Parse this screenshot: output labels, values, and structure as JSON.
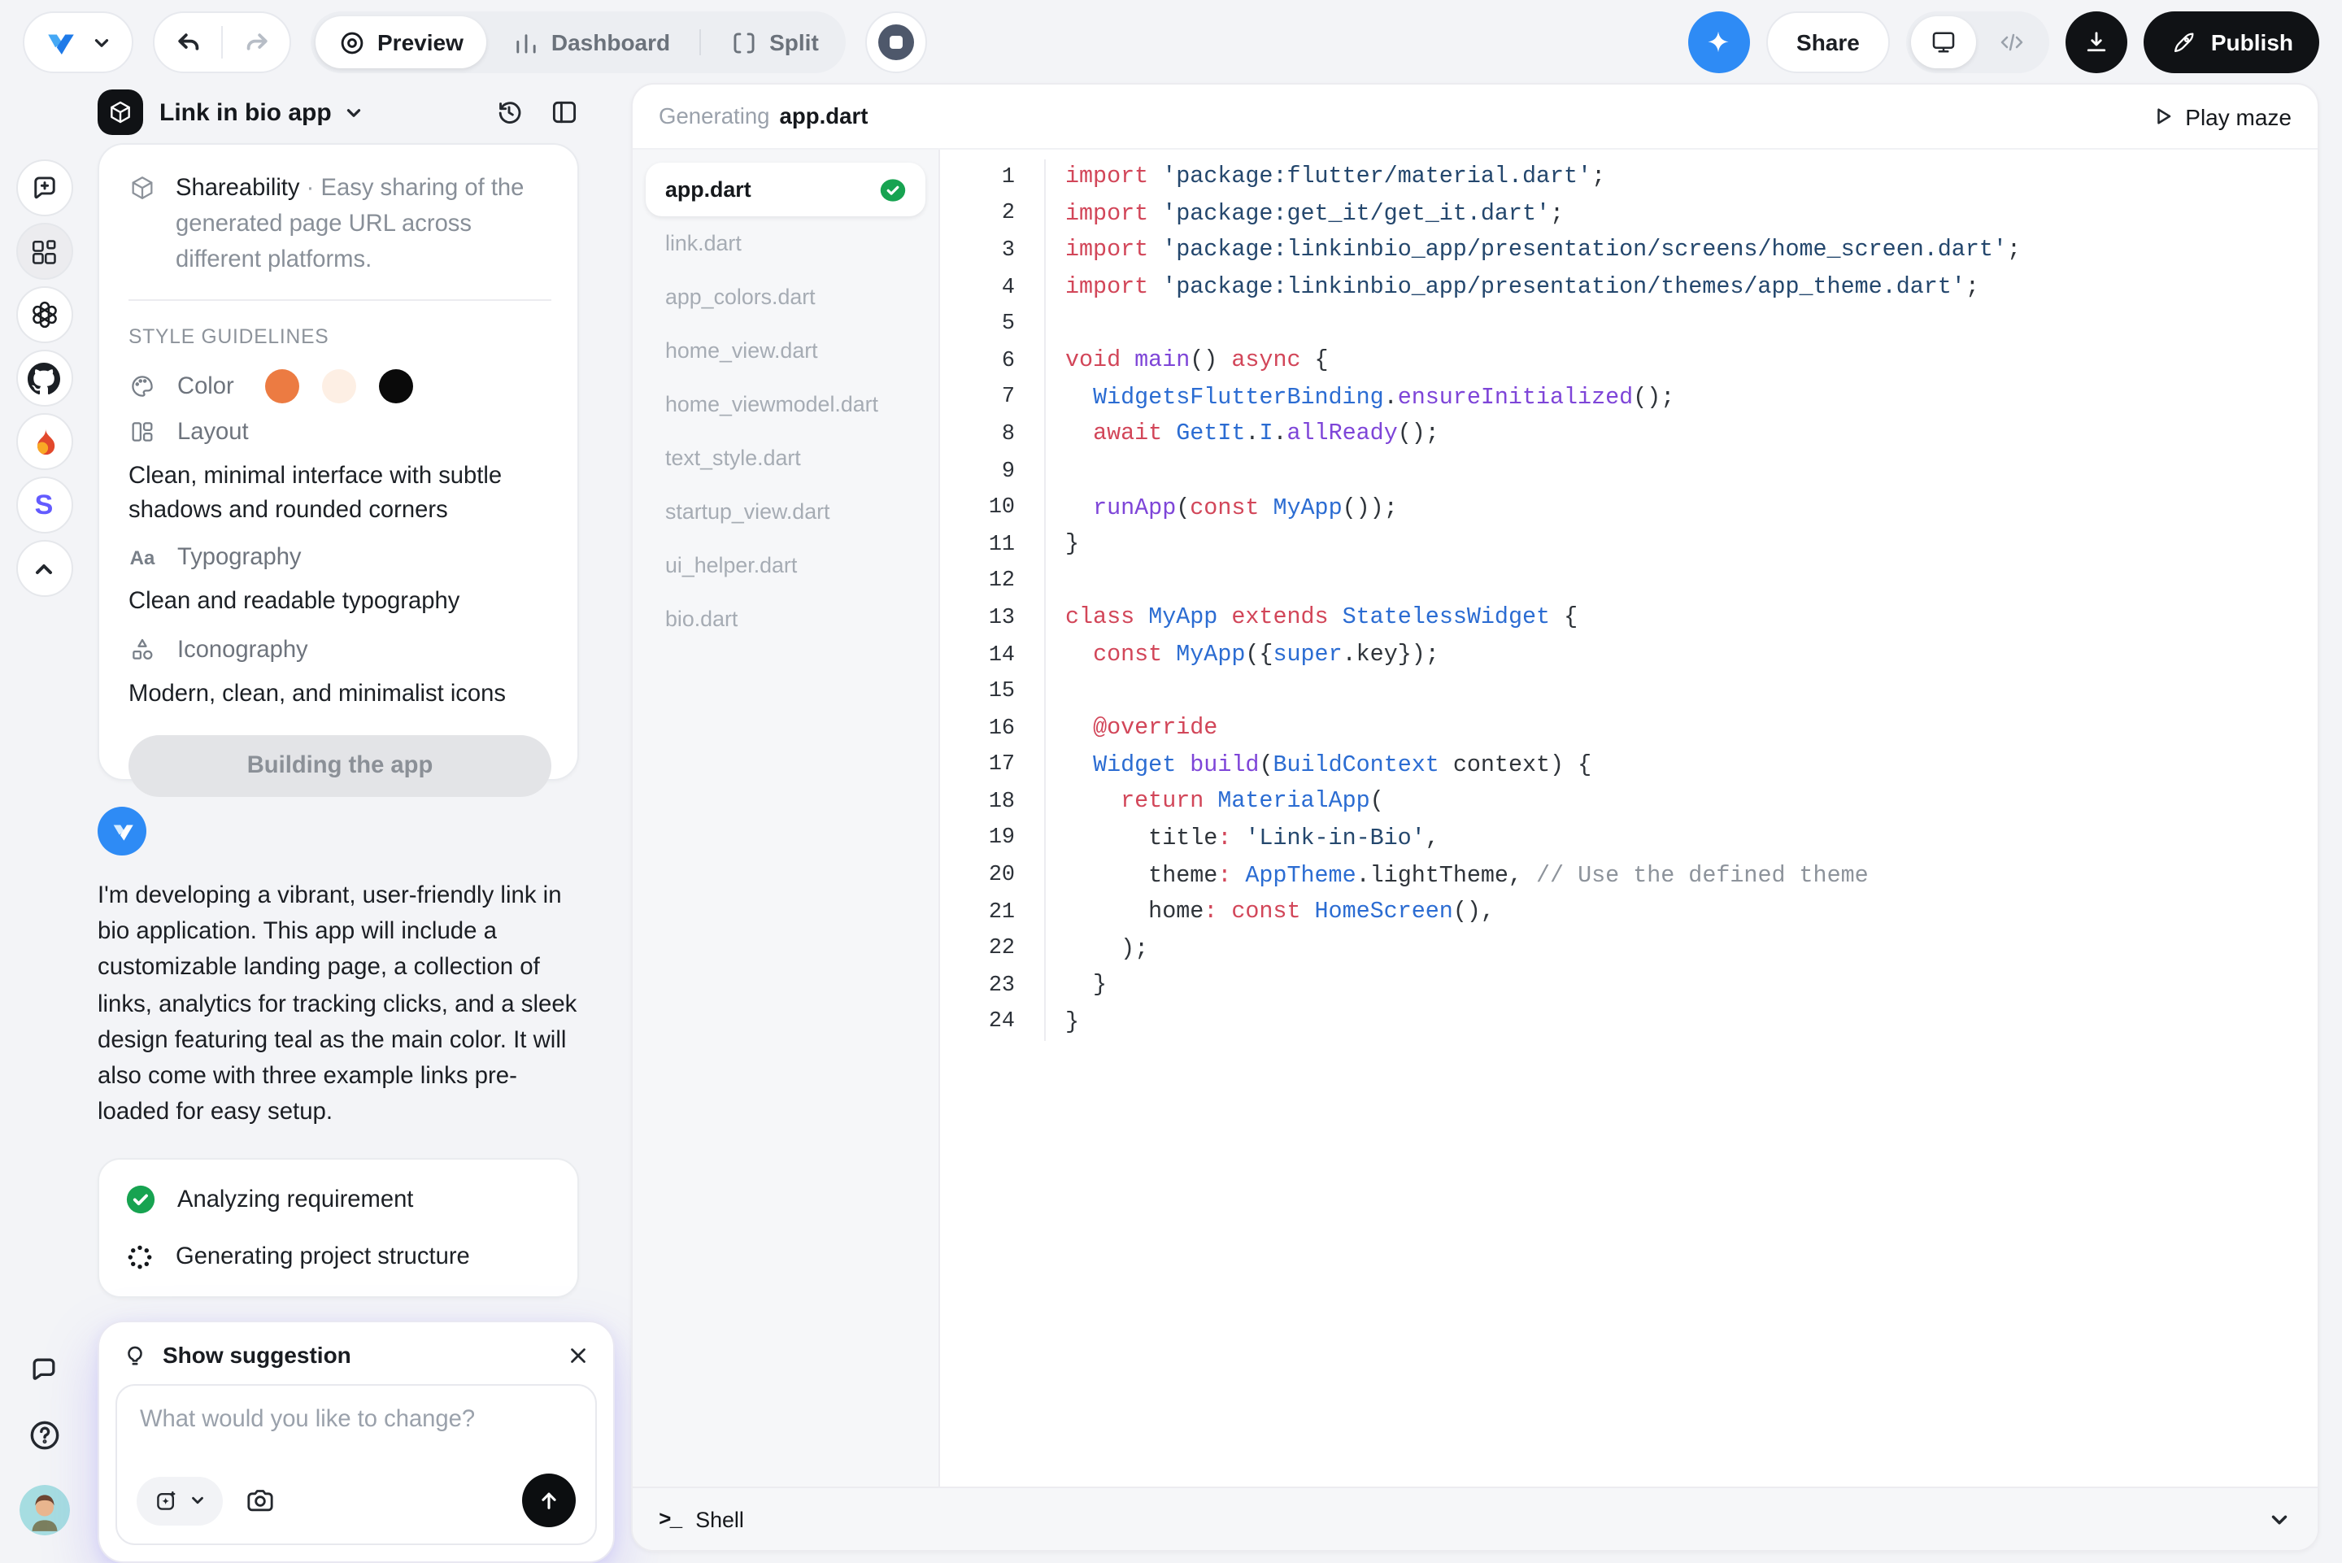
{
  "topbar": {
    "preview_label": "Preview",
    "dashboard_label": "Dashboard",
    "split_label": "Split",
    "share_label": "Share",
    "publish_label": "Publish"
  },
  "panel": {
    "title": "Link in bio app",
    "feature": {
      "name": "Shareability",
      "separator": "·",
      "desc": "Easy sharing of the generated page URL across different platforms."
    },
    "guidelines": {
      "heading": "STYLE GUIDELINES",
      "color_label": "Color",
      "swatches": [
        "#ec7b42",
        "#fdefe4",
        "#0a0a0a"
      ],
      "layout_label": "Layout",
      "layout_desc": "Clean, minimal interface with subtle shadows and rounded corners",
      "typography_label": "Typography",
      "typography_icon_text": "Aa",
      "typography_desc": "Clean and readable typography",
      "iconography_label": "Iconography",
      "iconography_desc": "Modern, clean, and minimalist icons"
    },
    "building_label": "Building the app",
    "message": "I'm developing a vibrant, user-friendly link in bio application. This app will include a customizable landing page, a collection of links, analytics for tracking clicks, and a sleek design featuring teal as the main color. It will also come with three example links pre-loaded for easy setup.",
    "status": [
      {
        "label": "Analyzing requirement",
        "state": "done"
      },
      {
        "label": "Generating project structure",
        "state": "loading"
      }
    ],
    "suggestion": {
      "title": "Show suggestion",
      "placeholder": "What would you like to change?"
    }
  },
  "rail": {
    "stripe_letter": "S"
  },
  "editor": {
    "header": {
      "prefix": "Generating",
      "file": "app.dart",
      "action": "Play maze"
    },
    "files": [
      {
        "name": "app.dart",
        "active": true,
        "badge": "check"
      },
      {
        "name": "link.dart"
      },
      {
        "name": "app_colors.dart"
      },
      {
        "name": "home_view.dart"
      },
      {
        "name": "home_viewmodel.dart"
      },
      {
        "name": "text_style.dart"
      },
      {
        "name": "startup_view.dart"
      },
      {
        "name": "ui_helper.dart"
      },
      {
        "name": "bio.dart"
      }
    ],
    "lines": [
      [
        [
          "kw",
          "import"
        ],
        [
          "pl",
          " "
        ],
        [
          "str",
          "'package:flutter/material.dart'"
        ],
        [
          "pl",
          ";"
        ]
      ],
      [
        [
          "kw",
          "import"
        ],
        [
          "pl",
          " "
        ],
        [
          "str",
          "'package:get_it/get_it.dart'"
        ],
        [
          "pl",
          ";"
        ]
      ],
      [
        [
          "kw",
          "import"
        ],
        [
          "pl",
          " "
        ],
        [
          "str",
          "'package:linkinbio_app/presentation/screens/home_screen.dart'"
        ],
        [
          "pl",
          ";"
        ]
      ],
      [
        [
          "kw",
          "import"
        ],
        [
          "pl",
          " "
        ],
        [
          "str",
          "'package:linkinbio_app/presentation/themes/app_theme.dart'"
        ],
        [
          "pl",
          ";"
        ]
      ],
      [],
      [
        [
          "kw",
          "void"
        ],
        [
          "pl",
          " "
        ],
        [
          "fn",
          "main"
        ],
        [
          "pl",
          "() "
        ],
        [
          "kw",
          "async"
        ],
        [
          "pl",
          " {"
        ]
      ],
      [
        [
          "pl",
          "  "
        ],
        [
          "ty",
          "WidgetsFlutterBinding"
        ],
        [
          "pl",
          "."
        ],
        [
          "fn",
          "ensureInitialized"
        ],
        [
          "pl",
          "();"
        ]
      ],
      [
        [
          "pl",
          "  "
        ],
        [
          "kw",
          "await"
        ],
        [
          "pl",
          " "
        ],
        [
          "ty",
          "GetIt"
        ],
        [
          "pl",
          "."
        ],
        [
          "ty",
          "I"
        ],
        [
          "pl",
          "."
        ],
        [
          "fn",
          "allReady"
        ],
        [
          "pl",
          "();"
        ]
      ],
      [],
      [
        [
          "pl",
          "  "
        ],
        [
          "fn",
          "runApp"
        ],
        [
          "pl",
          "("
        ],
        [
          "kw",
          "const"
        ],
        [
          "pl",
          " "
        ],
        [
          "ty",
          "MyApp"
        ],
        [
          "pl",
          "());"
        ]
      ],
      [
        [
          "pl",
          "}"
        ]
      ],
      [],
      [
        [
          "kw",
          "class"
        ],
        [
          "pl",
          " "
        ],
        [
          "ty",
          "MyApp"
        ],
        [
          "pl",
          " "
        ],
        [
          "kw",
          "extends"
        ],
        [
          "pl",
          " "
        ],
        [
          "ty",
          "StatelessWidget"
        ],
        [
          "pl",
          " {"
        ]
      ],
      [
        [
          "pl",
          "  "
        ],
        [
          "kw",
          "const"
        ],
        [
          "pl",
          " "
        ],
        [
          "ty",
          "MyApp"
        ],
        [
          "pl",
          "({"
        ],
        [
          "ty",
          "super"
        ],
        [
          "pl",
          ".key});"
        ]
      ],
      [],
      [
        [
          "pl",
          "  "
        ],
        [
          "kw",
          "@override"
        ]
      ],
      [
        [
          "pl",
          "  "
        ],
        [
          "ty",
          "Widget"
        ],
        [
          "pl",
          " "
        ],
        [
          "fn",
          "build"
        ],
        [
          "pl",
          "("
        ],
        [
          "ty",
          "BuildContext"
        ],
        [
          "pl",
          " context) {"
        ]
      ],
      [
        [
          "pl",
          "    "
        ],
        [
          "kw",
          "return"
        ],
        [
          "pl",
          " "
        ],
        [
          "ty",
          "MaterialApp"
        ],
        [
          "pl",
          "("
        ]
      ],
      [
        [
          "pl",
          "      title"
        ],
        [
          "kw",
          ":"
        ],
        [
          "pl",
          " "
        ],
        [
          "str",
          "'Link-in-Bio'"
        ],
        [
          "pl",
          ","
        ]
      ],
      [
        [
          "pl",
          "      theme"
        ],
        [
          "kw",
          ":"
        ],
        [
          "pl",
          " "
        ],
        [
          "ty",
          "AppTheme"
        ],
        [
          "pl",
          ".lightTheme, "
        ],
        [
          "cm",
          "// Use the defined theme"
        ]
      ],
      [
        [
          "pl",
          "      home"
        ],
        [
          "kw",
          ":"
        ],
        [
          "pl",
          " "
        ],
        [
          "kw",
          "const"
        ],
        [
          "pl",
          " "
        ],
        [
          "ty",
          "HomeScreen"
        ],
        [
          "pl",
          "(),"
        ]
      ],
      [
        [
          "pl",
          "    );"
        ]
      ],
      [
        [
          "pl",
          "  }"
        ]
      ],
      [
        [
          "pl",
          "}"
        ]
      ]
    ],
    "shell_label": "Shell",
    "shell_prompt": ">_"
  }
}
